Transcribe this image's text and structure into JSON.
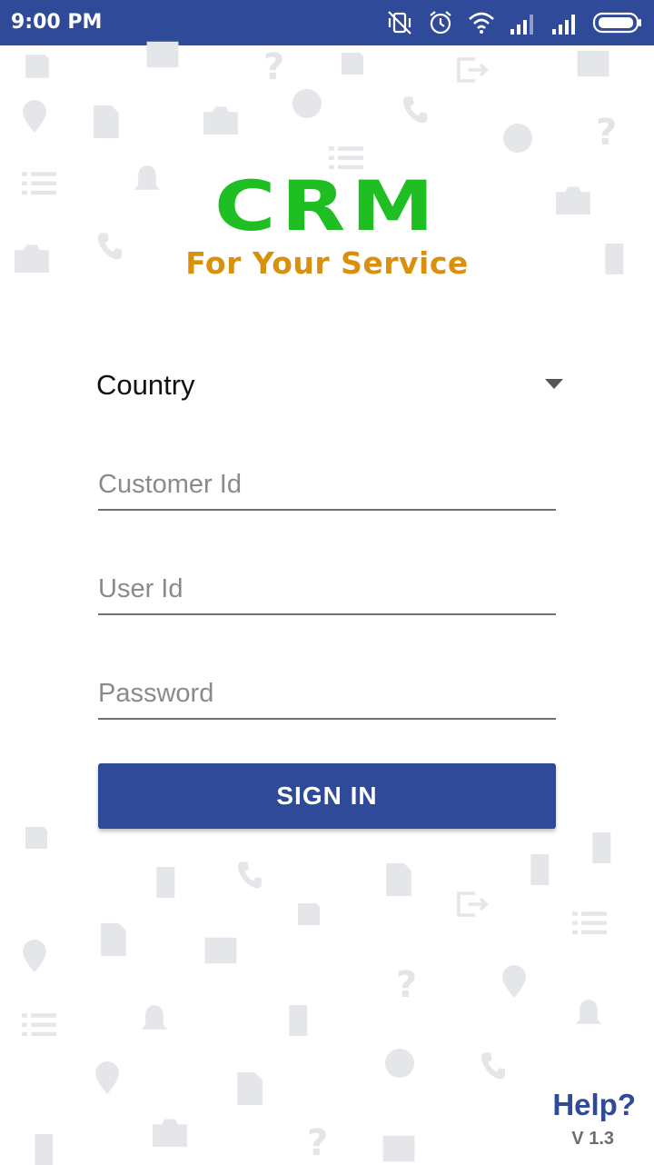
{
  "status_bar": {
    "time": "9:00 PM",
    "icons": [
      "vibrate-off-icon",
      "alarm-icon",
      "wifi-icon",
      "signal-icon",
      "signal-icon",
      "battery-icon"
    ]
  },
  "logo": {
    "title": "CRM",
    "tagline": "For Your Service",
    "colors": {
      "title": "#1fbf24",
      "tagline": "#d9900c"
    }
  },
  "form": {
    "country_label": "Country",
    "customer_id_placeholder": "Customer Id",
    "user_id_placeholder": "User Id",
    "password_placeholder": "Password",
    "sign_in_label": "SIGN IN"
  },
  "footer": {
    "help_label": "Help?",
    "version": "V 1.3"
  },
  "theme": {
    "primary": "#2f4a98"
  }
}
